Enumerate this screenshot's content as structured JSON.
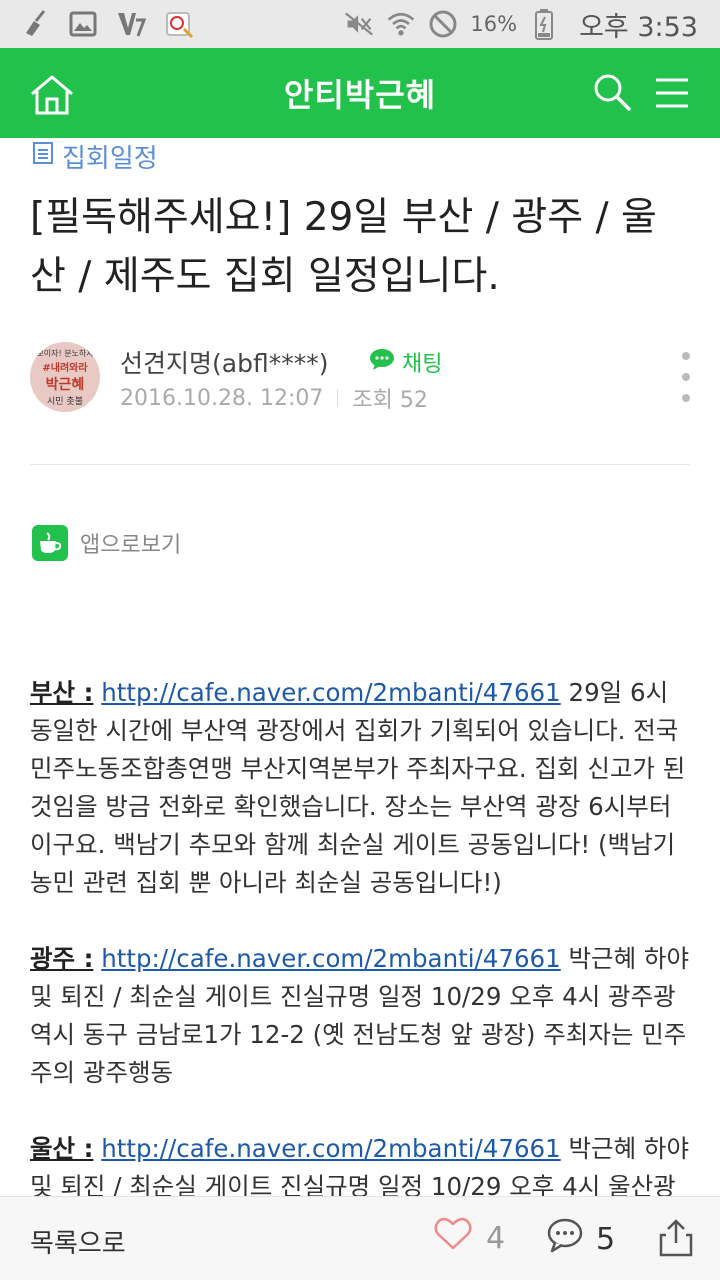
{
  "status_bar": {
    "battery_percent": "16%",
    "time": "오후 3:53",
    "icons": [
      "broom-icon",
      "image-icon",
      "v3-app-icon",
      "memo-app-icon",
      "mute-icon",
      "wifi-icon",
      "no-sign-icon",
      "battery-icon"
    ]
  },
  "app_bar": {
    "title": "안티박근혜",
    "color": "#22c14c"
  },
  "post": {
    "category": "집회일정",
    "title": "[필독해주세요!] 29일 부산 / 광주 / 울산 / 제주도 집회 일정입니다.",
    "author": "선견지명(abfl****)",
    "chat_label": "채팅",
    "date": "2016.10.28. 12:07",
    "views": "조회 52",
    "avatar_text": {
      "l1": "모이자! 분노하자",
      "l2": "#내려와라",
      "l3": "박근혜",
      "l4": "시민 촛불"
    }
  },
  "app_view_label": "앱으로보기",
  "body": {
    "busan": {
      "label": "부산 :",
      "link": "http://cafe.naver.com/2mbanti/47661",
      "text": " 29일 6시 동일한 시간에 부산역 광장에서 집회가 기획되어 있습니다. 전국민주노동조합총연맹 부산지역본부가 주최자구요. 집회 신고가 된 것임을 방금 전화로 확인했습니다. 장소는 부산역 광장 6시부터 이구요. 백남기 추모와 함께 최순실 게이트 공동입니다! (백남기 농민 관련 집회 뿐 아니라 최순실 공동입니다!)"
    },
    "gwangju": {
      "label": "광주 :",
      "link": "http://cafe.naver.com/2mbanti/47661",
      "text": " 박근혜 하야 및 퇴진 / 최순실 게이트 진실규명 일정 10/29 오후 4시 광주광역시 동구 금남로1가 12-2 (옛 전남도청 앞 광장) 주최자는 민주주의 광주행동"
    },
    "ulsan": {
      "label": "울산 :",
      "link": "http://cafe.naver.com/2mbanti/47661",
      "text": " 박근혜 하야 및 퇴진 / 최순실 게이트 진실규명 일정 10/29 오후 4시 울산광"
    }
  },
  "bottom_bar": {
    "list_label": "목록으로",
    "likes": "4",
    "comments": "5"
  }
}
